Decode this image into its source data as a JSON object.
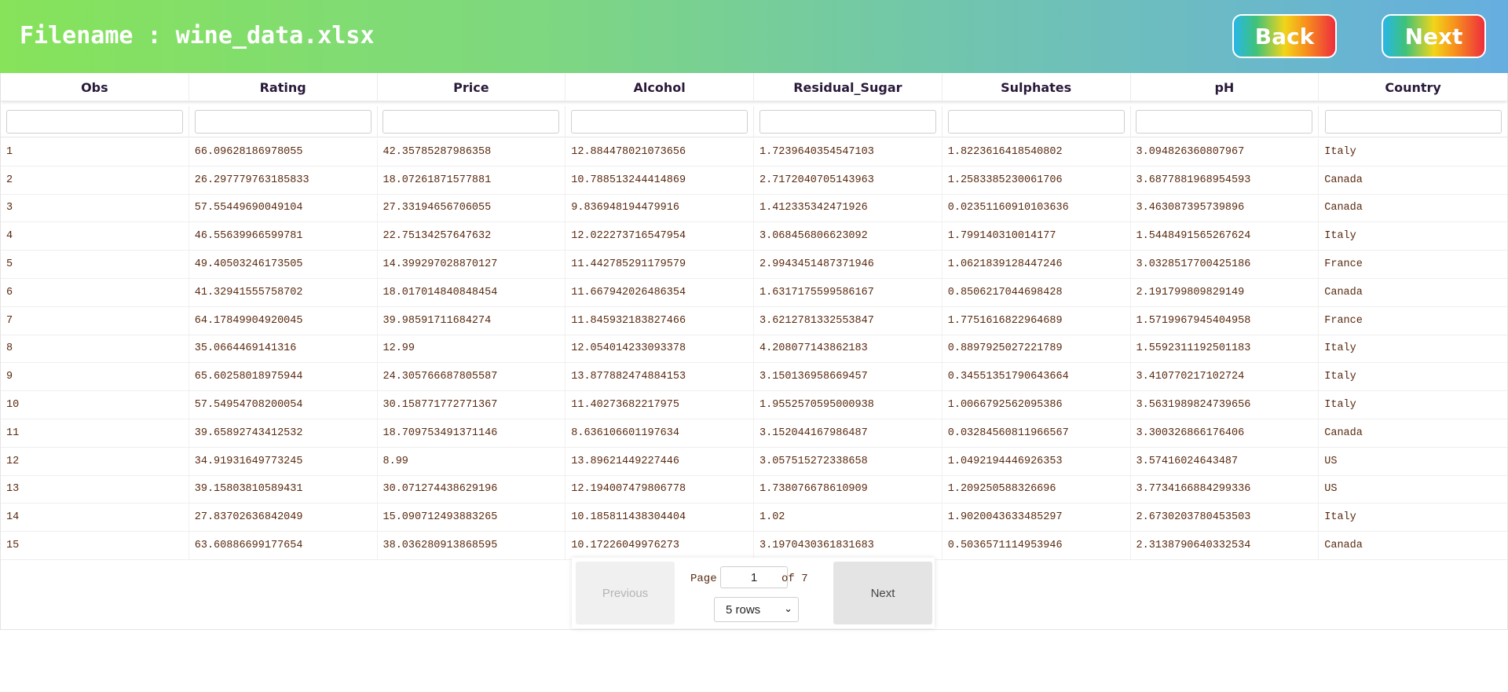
{
  "header": {
    "title": "Filename : wine_data.xlsx",
    "back_label": "Back",
    "next_label": "Next"
  },
  "table": {
    "columns": [
      "Obs",
      "Rating",
      "Price",
      "Alcohol",
      "Residual_Sugar",
      "Sulphates",
      "pH",
      "Country"
    ],
    "rows": [
      [
        "1",
        "66.09628186978055",
        "42.35785287986358",
        "12.884478021073656",
        "1.7239640354547103",
        "1.8223616418540802",
        "3.094826360807967",
        "Italy"
      ],
      [
        "2",
        "26.297779763185833",
        "18.07261871577881",
        "10.788513244414869",
        "2.7172040705143963",
        "1.2583385230061706",
        "3.6877881968954593",
        "Canada"
      ],
      [
        "3",
        "57.55449690049104",
        "27.33194656706055",
        "9.836948194479916",
        "1.412335342471926",
        "0.02351160910103636",
        "3.463087395739896",
        "Canada"
      ],
      [
        "4",
        "46.55639966599781",
        "22.75134257647632",
        "12.022273716547954",
        "3.068456806623092",
        "1.799140310014177",
        "1.5448491565267624",
        "Italy"
      ],
      [
        "5",
        "49.40503246173505",
        "14.399297028870127",
        "11.442785291179579",
        "2.9943451487371946",
        "1.0621839128447246",
        "3.0328517700425186",
        "France"
      ],
      [
        "6",
        "41.32941555758702",
        "18.017014840848454",
        "11.667942026486354",
        "1.6317175599586167",
        "0.8506217044698428",
        "2.191799809829149",
        "Canada"
      ],
      [
        "7",
        "64.17849904920045",
        "39.98591711684274",
        "11.845932183827466",
        "3.6212781332553847",
        "1.7751616822964689",
        "1.5719967945404958",
        "France"
      ],
      [
        "8",
        "35.0664469141316",
        "12.99",
        "12.054014233093378",
        "4.208077143862183",
        "0.8897925027221789",
        "1.5592311192501183",
        "Italy"
      ],
      [
        "9",
        "65.60258018975944",
        "24.305766687805587",
        "13.877882474884153",
        "3.150136958669457",
        "0.34551351790643664",
        "3.410770217102724",
        "Italy"
      ],
      [
        "10",
        "57.54954708200054",
        "30.158771772771367",
        "11.40273682217975",
        "1.9552570595000938",
        "1.0066792562095386",
        "3.5631989824739656",
        "Italy"
      ],
      [
        "11",
        "39.65892743412532",
        "18.709753491371146",
        "8.636106601197634",
        "3.152044167986487",
        "0.03284560811966567",
        "3.300326866176406",
        "Canada"
      ],
      [
        "12",
        "34.91931649773245",
        "8.99",
        "13.89621449227446",
        "3.057515272338658",
        "1.0492194446926353",
        "3.57416024643487",
        "US"
      ],
      [
        "13",
        "39.15803810589431",
        "30.071274438629196",
        "12.194007479806778",
        "1.738076678610909",
        "1.209250588326696",
        "3.7734166884299336",
        "US"
      ],
      [
        "14",
        "27.83702636842049",
        "15.090712493883265",
        "10.185811438304404",
        "1.02",
        "1.9020043633485297",
        "2.6730203780453503",
        "Italy"
      ],
      [
        "15",
        "63.60886699177654",
        "38.036280913868595",
        "10.17226049976273",
        "3.1970430361831683",
        "0.5036571114953946",
        "2.3138790640332534",
        "Canada"
      ]
    ]
  },
  "pagination": {
    "previous_label": "Previous",
    "next_label": "Next",
    "page_label": "Page",
    "page_value": "1",
    "of_label": "of 7",
    "rows_option": "5 rows"
  }
}
